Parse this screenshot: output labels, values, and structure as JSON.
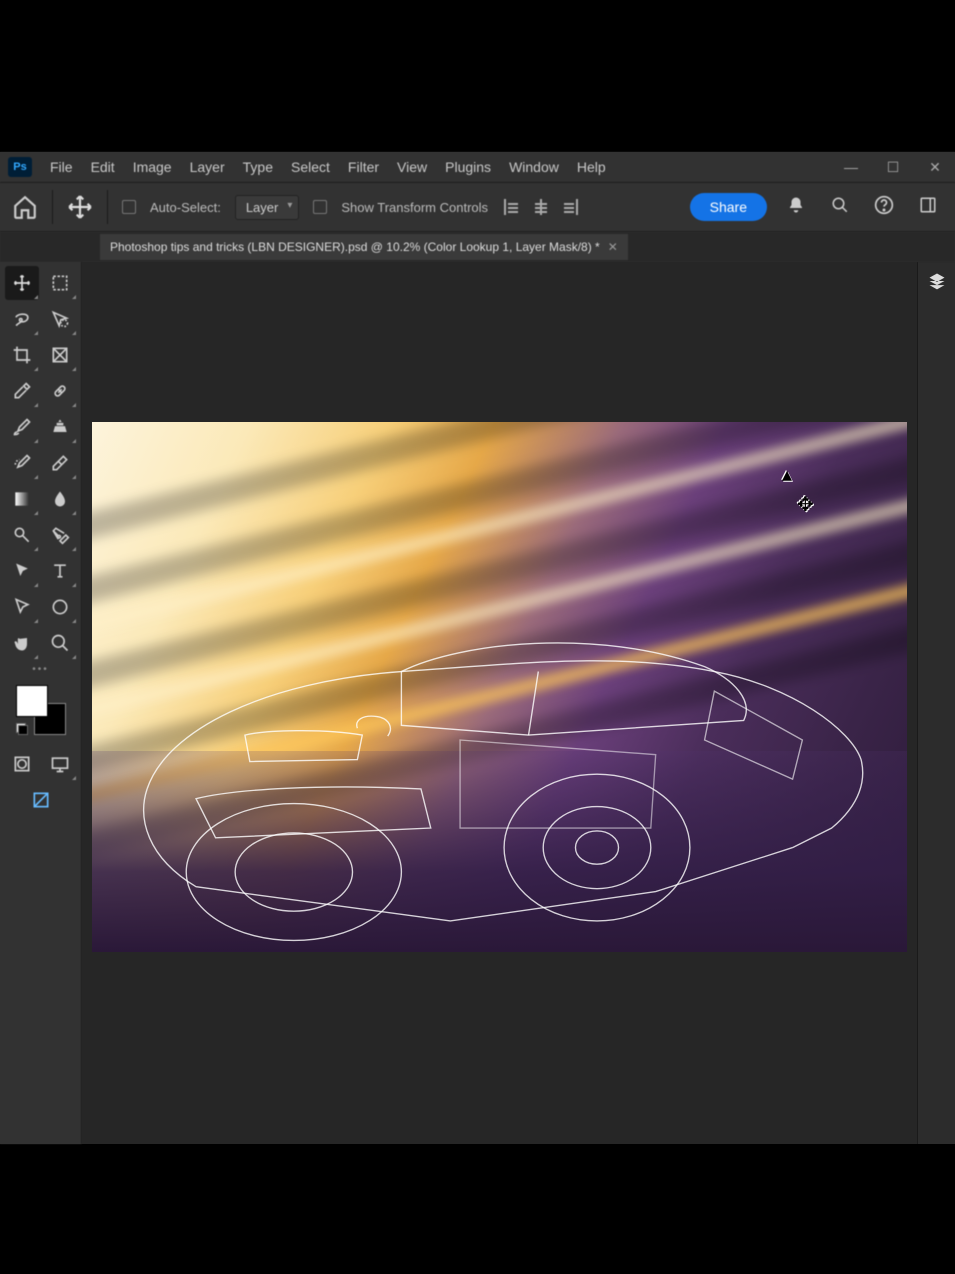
{
  "menu": {
    "items": [
      "File",
      "Edit",
      "Image",
      "Layer",
      "Type",
      "Select",
      "Filter",
      "View",
      "Plugins",
      "Window",
      "Help"
    ]
  },
  "options": {
    "auto_select_label": "Auto-Select:",
    "layer_dd": "Layer",
    "show_transform": "Show Transform Controls",
    "share": "Share"
  },
  "document": {
    "tab_title": "Photoshop tips and tricks (LBN DESIGNER).psd @ 10.2% (Color Lookup 1, Layer Mask/8) *"
  },
  "status": {
    "zoom": "10.2%"
  },
  "swatches": {
    "fg": "#ffffff",
    "bg": "#000000"
  },
  "tools": [
    [
      "move",
      "artboard"
    ],
    [
      "lasso",
      "quick-select"
    ],
    [
      "crop",
      "frame"
    ],
    [
      "eyedrop",
      "healing"
    ],
    [
      "brush",
      "clone"
    ],
    [
      "history",
      "eraser"
    ],
    [
      "gradient",
      "smudge"
    ],
    [
      "dodge",
      "pen"
    ],
    [
      "path",
      "type"
    ],
    [
      "pointer",
      "ellipse"
    ],
    [
      "hand",
      "zoom"
    ]
  ]
}
